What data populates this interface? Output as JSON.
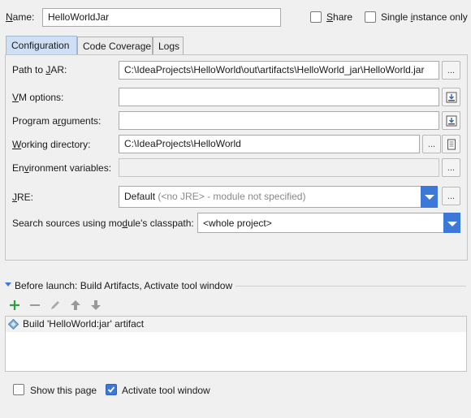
{
  "header": {
    "name_label": "Name:",
    "name_value": "HelloWorldJar",
    "share_label": "Share",
    "single_instance_label": "Single instance only"
  },
  "tabs": [
    {
      "label": "Configuration",
      "active": true
    },
    {
      "label": "Code Coverage",
      "active": false
    },
    {
      "label": "Logs",
      "active": false
    }
  ],
  "config": {
    "path_to_jar_label": "Path to JAR:",
    "path_to_jar_value": "C:\\IdeaProjects\\HelloWorld\\out\\artifacts\\HelloWorld_jar\\HelloWorld.jar",
    "vm_options_label": "VM options:",
    "vm_options_value": "",
    "program_args_label": "Program arguments:",
    "program_args_value": "",
    "working_dir_label": "Working directory:",
    "working_dir_value": "C:\\IdeaProjects\\HelloWorld",
    "env_vars_label": "Environment variables:",
    "env_vars_value": "",
    "jre_label": "JRE:",
    "jre_default": "Default",
    "jre_hint": "(<no JRE> - module not specified)",
    "search_sources_label": "Search sources using module's classpath:",
    "search_sources_value": "<whole project>",
    "browse_glyph": "..."
  },
  "before_launch": {
    "title": "Before launch: Build Artifacts, Activate tool window",
    "items": [
      "Build 'HelloWorld:jar' artifact"
    ]
  },
  "footer": {
    "show_page_label": "Show this page",
    "show_page_checked": false,
    "activate_tool_label": "Activate tool window",
    "activate_tool_checked": true
  },
  "colors": {
    "accent": "#3c78d8",
    "add_icon": "#2e9e3e",
    "tab_active_bg": "#cfe0f5"
  },
  "icons": [
    "add-icon",
    "remove-icon",
    "edit-icon",
    "move-up-icon",
    "move-down-icon",
    "expand-field-icon",
    "file-icon",
    "artifact-icon",
    "collapse-triangle-icon",
    "checkmark-icon"
  ]
}
